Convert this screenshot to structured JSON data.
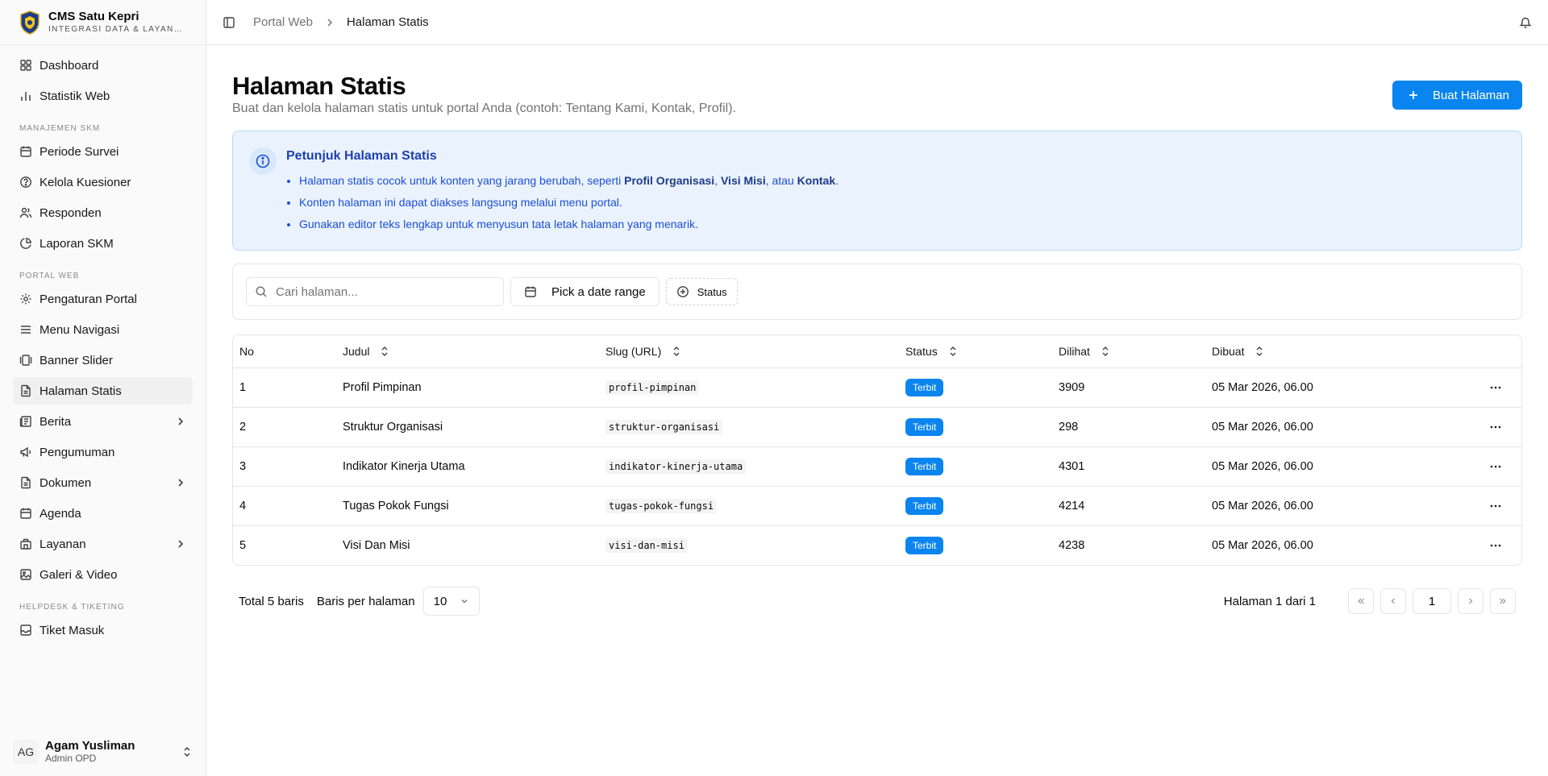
{
  "brand": {
    "title": "CMS Satu Kepri",
    "subtitle": "INTEGRASI DATA & LAYANAN PUBLIK"
  },
  "sidebar": {
    "top": [
      {
        "label": "Dashboard",
        "icon": "dashboard-icon"
      },
      {
        "label": "Statistik Web",
        "icon": "bar-chart-icon"
      }
    ],
    "groups": [
      {
        "label": "MANAJEMEN SKM",
        "items": [
          {
            "label": "Periode Survei",
            "icon": "calendar-icon"
          },
          {
            "label": "Kelola Kuesioner",
            "icon": "help-circle-icon"
          },
          {
            "label": "Responden",
            "icon": "users-icon"
          },
          {
            "label": "Laporan SKM",
            "icon": "pie-chart-icon"
          }
        ]
      },
      {
        "label": "PORTAL WEB",
        "items": [
          {
            "label": "Pengaturan Portal",
            "icon": "gear-icon"
          },
          {
            "label": "Menu Navigasi",
            "icon": "menu-icon"
          },
          {
            "label": "Banner Slider",
            "icon": "gallery-icon"
          },
          {
            "label": "Halaman Statis",
            "icon": "file-icon"
          },
          {
            "label": "Berita",
            "icon": "newspaper-icon"
          },
          {
            "label": "Pengumuman",
            "icon": "megaphone-icon"
          },
          {
            "label": "Dokumen",
            "icon": "file-icon"
          },
          {
            "label": "Agenda",
            "icon": "calendar-icon"
          },
          {
            "label": "Layanan",
            "icon": "building-icon"
          },
          {
            "label": "Galeri & Video",
            "icon": "image-icon"
          }
        ]
      },
      {
        "label": "HELPDESK & TIKETING",
        "items": [
          {
            "label": "Tiket Masuk",
            "icon": "inbox-icon"
          }
        ]
      }
    ]
  },
  "user": {
    "initials": "AG",
    "name": "Agam Yusliman",
    "role": "Admin OPD"
  },
  "breadcrumb": {
    "parent": "Portal Web",
    "current": "Halaman Statis"
  },
  "page": {
    "title": "Halaman Statis",
    "subtitle": "Buat dan kelola halaman statis untuk portal Anda (contoh: Tentang Kami, Kontak, Profil).",
    "create_label": "Buat Halaman"
  },
  "info": {
    "title": "Petunjuk Halaman Statis",
    "line1_pre": "Halaman statis cocok untuk konten yang jarang berubah, seperti ",
    "line1_b1": "Profil Organisasi",
    "line1_sep": ", ",
    "line1_b2": "Visi Misi",
    "line1_mid": ", atau ",
    "line1_b3": "Kontak",
    "line1_end": ".",
    "line2": "Konten halaman ini dapat diakses langsung melalui menu portal.",
    "line3": "Gunakan editor teks lengkap untuk menyusun tata letak halaman yang menarik."
  },
  "filters": {
    "search_placeholder": "Cari halaman...",
    "date_label": "Pick a date range",
    "status_label": "Status"
  },
  "table": {
    "headers": {
      "no": "No",
      "judul": "Judul",
      "slug": "Slug (URL)",
      "status": "Status",
      "dilihat": "Dilihat",
      "dibuat": "Dibuat"
    },
    "rows": [
      {
        "no": "1",
        "judul": "Profil Pimpinan",
        "slug": "profil-pimpinan",
        "status": "Terbit",
        "dilihat": "3909",
        "dibuat": "05 Mar 2026, 06.00"
      },
      {
        "no": "2",
        "judul": "Struktur Organisasi",
        "slug": "struktur-organisasi",
        "status": "Terbit",
        "dilihat": "298",
        "dibuat": "05 Mar 2026, 06.00"
      },
      {
        "no": "3",
        "judul": "Indikator Kinerja Utama",
        "slug": "indikator-kinerja-utama",
        "status": "Terbit",
        "dilihat": "4301",
        "dibuat": "05 Mar 2026, 06.00"
      },
      {
        "no": "4",
        "judul": "Tugas Pokok Fungsi",
        "slug": "tugas-pokok-fungsi",
        "status": "Terbit",
        "dilihat": "4214",
        "dibuat": "05 Mar 2026, 06.00"
      },
      {
        "no": "5",
        "judul": "Visi Dan Misi",
        "slug": "visi-dan-misi",
        "status": "Terbit",
        "dilihat": "4238",
        "dibuat": "05 Mar 2026, 06.00"
      }
    ]
  },
  "pagination": {
    "total": "Total 5 baris",
    "per_page_label": "Baris per halaman",
    "per_page_value": "10",
    "page_info": "Halaman 1 dari 1",
    "current_page": "1"
  },
  "colors": {
    "primary": "#0a84ee",
    "info_bg": "#eaf3fd",
    "info_text": "#1d4ed8"
  }
}
